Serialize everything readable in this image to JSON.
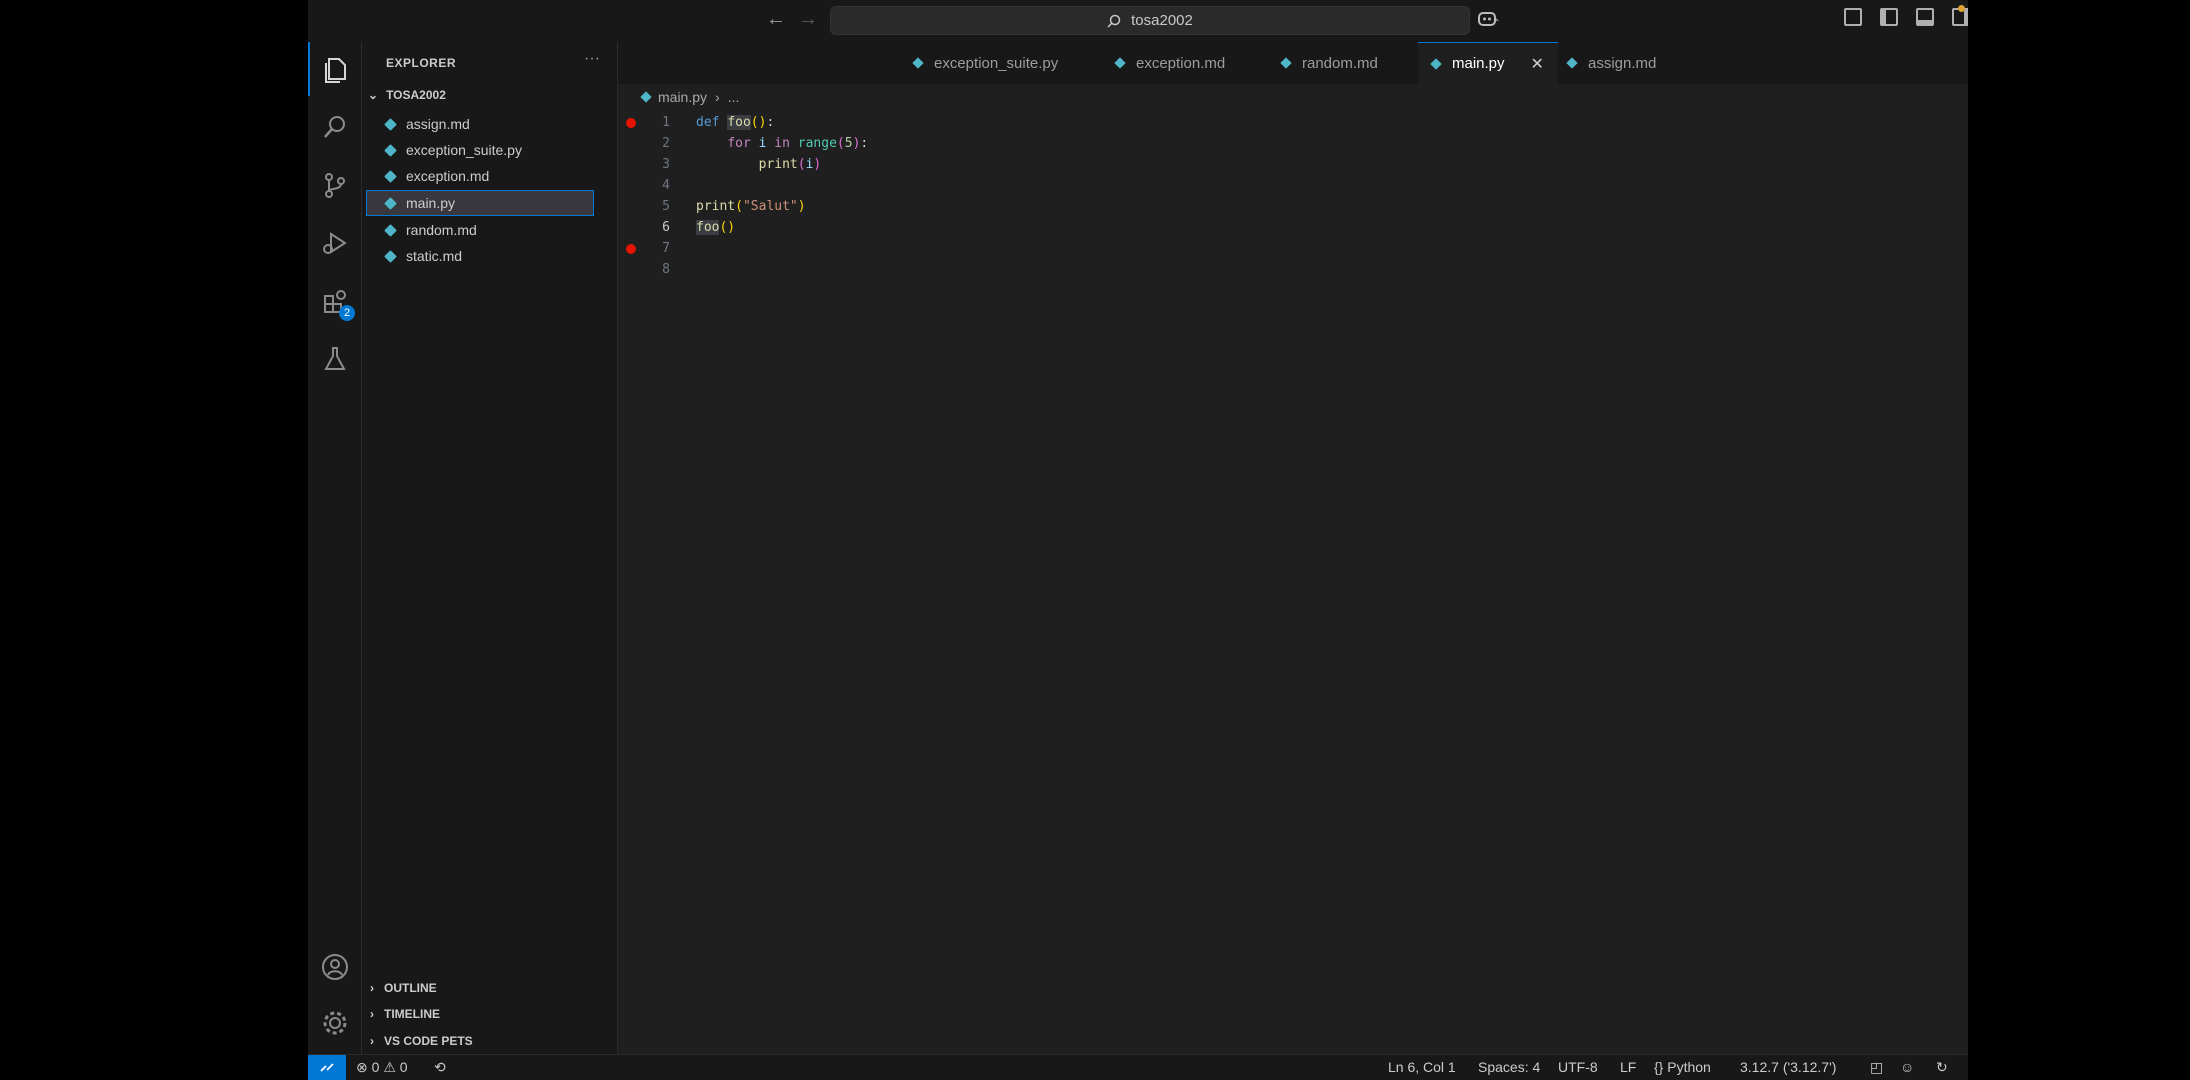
{
  "titlebar": {
    "search_text": "tosa2002",
    "back": "←",
    "forward": "→"
  },
  "activity": {
    "extensions_badge": "2"
  },
  "sidebar": {
    "title": "EXPLORER",
    "more": "···",
    "folder": "TOSA2002",
    "files": [
      {
        "name": "assign.md"
      },
      {
        "name": "exception_suite.py"
      },
      {
        "name": "exception.md"
      },
      {
        "name": "main.py"
      },
      {
        "name": "random.md"
      },
      {
        "name": "static.md"
      }
    ],
    "sections": [
      "OUTLINE",
      "TIMELINE",
      "VS CODE PETS"
    ]
  },
  "tabs": [
    {
      "label": "exception_suite.py"
    },
    {
      "label": "exception.md"
    },
    {
      "label": "random.md"
    },
    {
      "label": "main.py"
    },
    {
      "label": "assign.md"
    }
  ],
  "tab_close": "✕",
  "breadcrumb": {
    "file": "main.py",
    "sep": "›",
    "rest": "..."
  },
  "editor": {
    "lines": [
      {
        "n": "1",
        "text": "def foo():"
      },
      {
        "n": "2",
        "text": "    for i in range(5):"
      },
      {
        "n": "3",
        "text": "        print(i)"
      },
      {
        "n": "4",
        "text": ""
      },
      {
        "n": "5",
        "text": "print(\"Salut\")"
      },
      {
        "n": "6",
        "text": "foo()"
      },
      {
        "n": "7",
        "text": ""
      },
      {
        "n": "8",
        "text": ""
      }
    ]
  },
  "statusbar": {
    "errors": "0",
    "warnings": "0",
    "position": "Ln 6, Col 1",
    "spaces": "Spaces: 4",
    "encoding": "UTF-8",
    "eol": "LF",
    "language": "Python",
    "interpreter": "3.12.7 ('3.12.7')"
  },
  "colors": {
    "accent": "#0078d4",
    "breakpoint": "#e51400",
    "file_icon": "#4fb6c9"
  }
}
